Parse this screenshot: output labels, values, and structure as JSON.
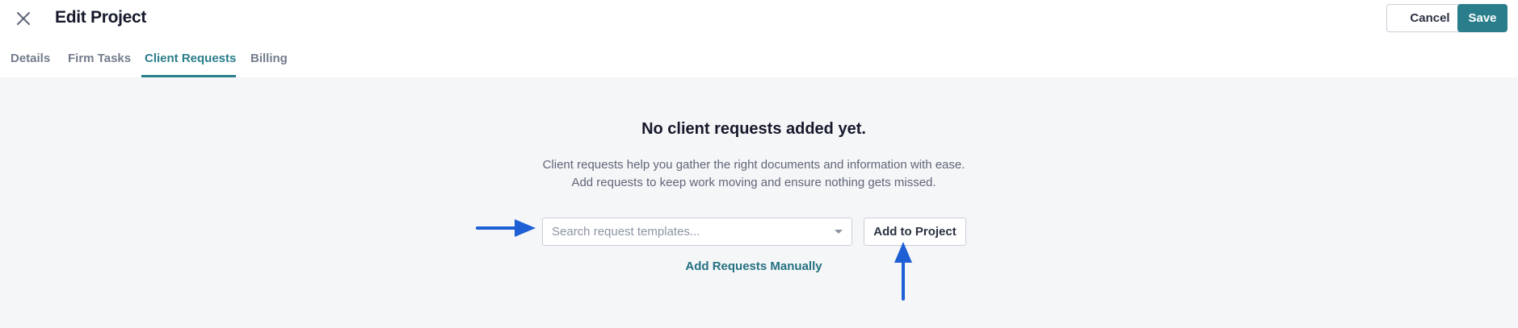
{
  "header": {
    "close_icon": "close-icon",
    "title": "Edit Project",
    "cancel_label": "Cancel",
    "save_label": "Save",
    "save_color": "#2a7d8b"
  },
  "tabs": [
    {
      "label": "Details",
      "active": false
    },
    {
      "label": "Firm Tasks",
      "active": false
    },
    {
      "label": "Client Requests",
      "active": true
    },
    {
      "label": "Billing",
      "active": false
    }
  ],
  "empty_state": {
    "heading": "No client requests added yet.",
    "description_line1": "Client requests help you gather the right documents and information with ease.",
    "description_line2": "Add requests to keep work moving and ensure nothing gets missed.",
    "search_placeholder": "Search request templates...",
    "search_value": "",
    "dropdown_icon": "chevron-down-icon",
    "add_button_label": "Add to Project",
    "manual_link_label": "Add Requests Manually"
  },
  "annotations": {
    "arrow_color": "#1f5fd6",
    "arrows": [
      "arrow-right-icon",
      "arrow-up-icon"
    ]
  }
}
